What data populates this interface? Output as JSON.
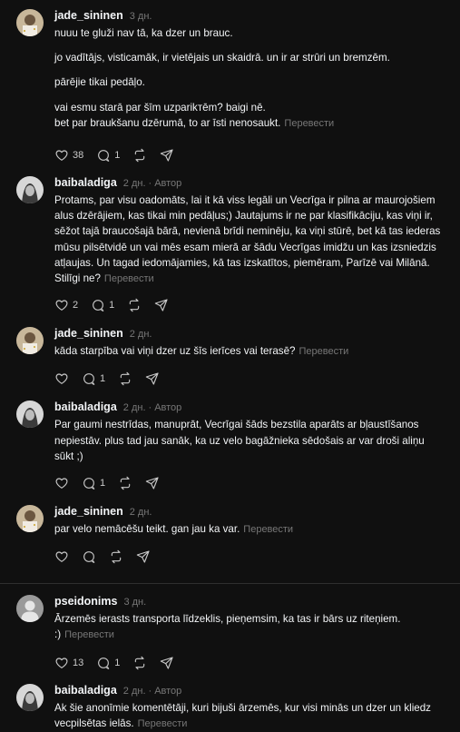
{
  "translate_label": "Перевести",
  "icons": [
    "heart-icon",
    "comment-icon",
    "repost-icon",
    "share-icon"
  ],
  "posts": [
    {
      "user": "jade_sininen",
      "time": "3 дн.",
      "author_badge": "",
      "paragraphs": [
        "nuuu te gluži nav tā, ka dzer un brauc.",
        "jo vadītājs, visticamāk, ir vietējais un skaidrā. un ir ar strūri un bremzēm.",
        "pārējie tikai pedāļo.",
        "vai esmu starā par šīm uzparikтēm? baigi nē.",
        "bet par braukšanu dzērumā, to ar īsti nenosaukt."
      ],
      "likes": "38",
      "comments": "1"
    },
    {
      "user": "baibaladiga",
      "time": "2 дн.",
      "author_badge": "Автор",
      "paragraphs": [
        "Protams, par visu oadomāts, lai it kā viss legāli un Vecrīga ir pilna ar maurojošiem alus dzērājiem, kas tikai min pedāļus;) Jautajums ir ne par klasifikāciju, kas viņi ir, sēžot tajā braucošajā bārā, nevienā brīdi neminēju, ka viņi stūrē, bet kā tas iederas mūsu pilsētvidē un vai mēs esam mierā ar šādu Vecrīgas imidžu un kas izsniedzis atļaujas. Un tagad iedomājamies, kā tas izskatītos, piemēram, Parīzē vai Milānā. Stilīgi ne?"
      ],
      "likes": "2",
      "comments": "1"
    },
    {
      "user": "jade_sininen",
      "time": "2 дн.",
      "author_badge": "",
      "paragraphs": [
        "kāda starpība vai viņi dzer uz šīs ierīces vai terasē?"
      ],
      "likes": "",
      "comments": "1"
    },
    {
      "user": "baibaladiga",
      "time": "2 дн.",
      "author_badge": "Автор",
      "paragraphs": [
        "Par gaumi nestrīdas, manuprāt, Vecrīgai šāds bezstila aparāts ar bļaustīšanos nepiestāv. plus tad jau sanāk, ka uz velo bagāžnieka sēdošais ar var droši aliņu sūkt ;)"
      ],
      "likes": "",
      "comments": "1"
    },
    {
      "user": "jade_sininen",
      "time": "2 дн.",
      "author_badge": "",
      "paragraphs": [
        "par velo nemācēšu teikt. gan jau ka var."
      ],
      "likes": "",
      "comments": ""
    },
    {
      "user": "pseidonims",
      "time": "3 дн.",
      "author_badge": "",
      "paragraphs": [
        "Ārzemēs ierasts transporta līdzeklis, pieņemsim, ka tas ir bārs uz riteņiem. :)"
      ],
      "likes": "13",
      "comments": "1"
    },
    {
      "user": "baibaladiga",
      "time": "2 дн.",
      "author_badge": "Автор",
      "paragraphs": [
        "Ak šie anonīmie komentētāji, kuri bijuši ārzemēs, kur visi minās un dzer un kliedz vecpilsētas ielās."
      ],
      "likes": "",
      "comments": ""
    }
  ]
}
